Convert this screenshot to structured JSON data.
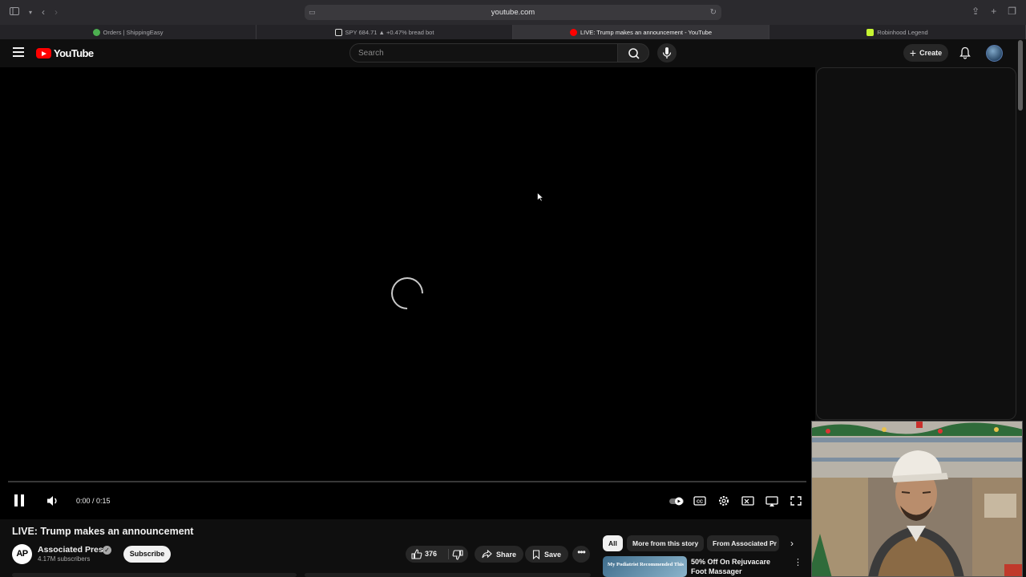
{
  "browser": {
    "url": "youtube.com",
    "tabs": [
      {
        "label": "Orders | ShippingEasy",
        "favicon_color": "#4caf50"
      },
      {
        "label": "SPY 684.71 ▲ +0.47% bread bot",
        "favicon_color": "#ffffff"
      },
      {
        "label": "LIVE: Trump makes an announcement - YouTube",
        "favicon_color": "#ff0000"
      },
      {
        "label": "Robinhood Legend",
        "favicon_color": "#c6f432"
      }
    ]
  },
  "header": {
    "logo_text": "YouTube",
    "search_placeholder": "Search",
    "create_label": "Create"
  },
  "player": {
    "time": "0:00 / 0:15",
    "state": "loading",
    "progress": 0
  },
  "video": {
    "title": "LIVE: Trump makes an announcement",
    "channel": {
      "name": "Associated Press",
      "avatar_text": "AP",
      "subscribers": "4.17M subscribers",
      "verified": true
    },
    "subscribe_label": "Subscribe",
    "likes": "376",
    "share_label": "Share",
    "save_label": "Save"
  },
  "chips": [
    "All",
    "More from this story",
    "From Associated Pr"
  ],
  "recommended": [
    {
      "thumb_text": "My Podiatrist Recommended This",
      "title": "50% Off On Rejuvacare Foot Massager"
    }
  ],
  "colors": {
    "background": "#0f0f0f",
    "brand_red": "#ff0000",
    "chip_bg": "#272727"
  }
}
